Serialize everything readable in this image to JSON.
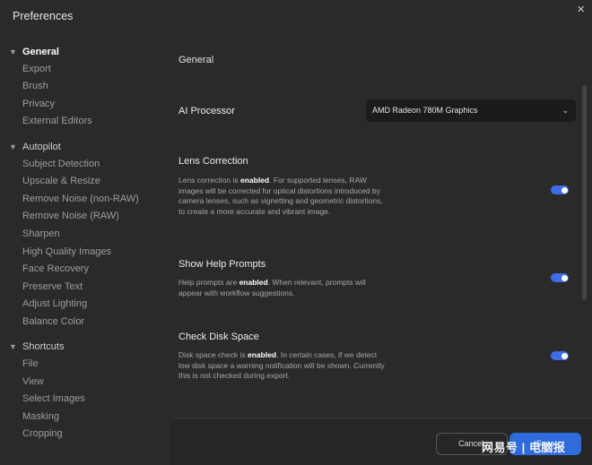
{
  "window": {
    "title": "Preferences",
    "close_glyph": "×"
  },
  "sidebar": {
    "sections": [
      {
        "label": "General",
        "active": true,
        "items": [
          "Export",
          "Brush",
          "Privacy",
          "External Editors"
        ]
      },
      {
        "label": "Autopilot",
        "active": false,
        "items": [
          "Subject Detection",
          "Upscale & Resize",
          "Remove Noise (non-RAW)",
          "Remove Noise (RAW)",
          "Sharpen",
          "High Quality Images",
          "Face Recovery",
          "Preserve Text",
          "Adjust Lighting",
          "Balance Color"
        ]
      },
      {
        "label": "Shortcuts",
        "active": false,
        "items": [
          "File",
          "View",
          "Select Images",
          "Masking",
          "Cropping"
        ]
      }
    ]
  },
  "main": {
    "page_title": "General",
    "ai_processor": {
      "label": "AI Processor",
      "value": "AMD Radeon 780M Graphics"
    },
    "lens_correction": {
      "label": "Lens Correction",
      "desc_before": "Lens correction is ",
      "desc_state": "enabled",
      "desc_after": ". For supported lenses, RAW images will be corrected for optical distortions introduced by camera lenses, such as vignetting and geometric distortions, to create a more accurate and vibrant image.",
      "enabled": true
    },
    "help_prompts": {
      "label": "Show Help Prompts",
      "desc_before": "Help prompts are ",
      "desc_state": "enabled",
      "desc_after": ". When relevant, prompts will appear with workflow suggestions.",
      "enabled": true
    },
    "disk_space": {
      "label": "Check Disk Space",
      "desc_before": "Disk space check is ",
      "desc_state": "enabled",
      "desc_after": ". In certain cases, if we detect low disk space a warning notification will be shown. Currently this is not checked during export.",
      "enabled": true
    }
  },
  "footer": {
    "cancel_label": "Cancel",
    "save_label": "Save"
  },
  "watermark": {
    "text": "网易号 | 电脑报"
  },
  "colors": {
    "accent": "#3f6ce5",
    "background": "#2a2a2a",
    "select_bg": "#1b1b1b"
  }
}
